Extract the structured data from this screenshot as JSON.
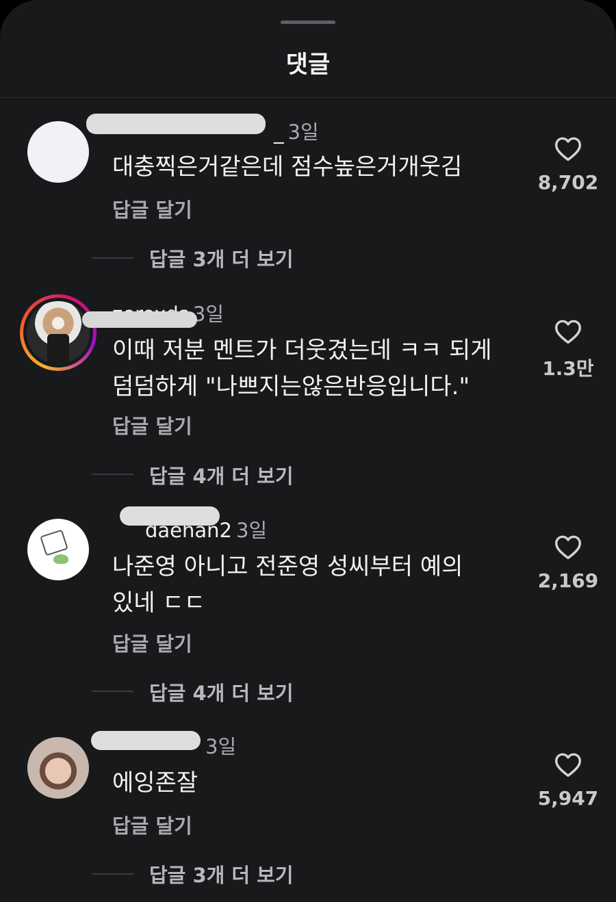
{
  "sheet": {
    "title": "댓글"
  },
  "comments": [
    {
      "username": "_",
      "time": "3일",
      "text": "대충찍은거같은데 점수높은거개웃김",
      "reply_label": "답글 달기",
      "more_replies": "답글 3개 더 보기",
      "likes": "8,702",
      "avatar": "blank-avatar"
    },
    {
      "username": "zeroxds",
      "time": "3일",
      "text": "이때 저분 멘트가 더웃겼는데 ㅋㅋ 되게 덤덤하게 \"나쁘지는않은반응입니다.\"",
      "reply_label": "답글 달기",
      "more_replies": "답글 4개 더 보기",
      "likes": "1.3만",
      "avatar": "photo-avatar-with-story-ring"
    },
    {
      "username": "daehan2",
      "time": "3일",
      "text": "나준영 아니고 전준영  성씨부터 예의있네 ㄷㄷ",
      "reply_label": "답글 달기",
      "more_replies": "답글 4개 더 보기",
      "likes": "2,169",
      "avatar": "sticker-avatar"
    },
    {
      "username": "",
      "time": "3일",
      "text": "에잉존잘",
      "reply_label": "답글 달기",
      "more_replies": "답글 3개 더 보기",
      "likes": "5,947",
      "avatar": "selfie-avatar"
    }
  ],
  "colors": {
    "background": "#18191b",
    "text": "#f2f2f2",
    "muted": "#a9aaad"
  },
  "icons": {
    "like": "heart-outline-icon"
  }
}
